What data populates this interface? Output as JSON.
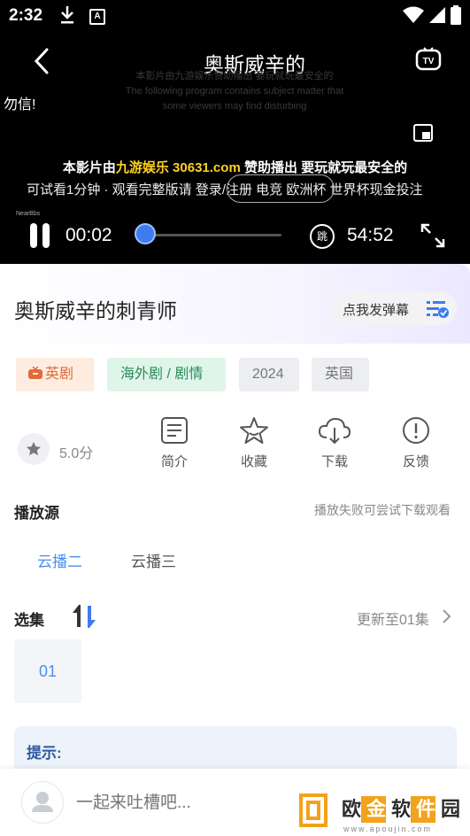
{
  "status_bar": {
    "time": "2:32",
    "notif_letter": "A"
  },
  "player": {
    "title": "奥斯威辛的",
    "danmaku_line": "勿信!",
    "faint_lines": [
      "本影片由九游娱乐赞助播出 要玩就玩最安全的",
      "The following program contains subject matter that",
      "some viewers may find disturbing"
    ],
    "sponsor_prefix": "本影片由",
    "sponsor_brand": "九游娱乐 30631.com",
    "sponsor_suffix": " 赞助播出 要玩就玩最安全的",
    "sponsor_line2": "世界杯现金投注",
    "overlay_line": "可试看1分钟 · 观看完整版请 登录/注册 电竞 欧洲杯 世界杯现金投注",
    "watermark_small": "NearBbs",
    "current_time": "00:02",
    "total_time": "54:52",
    "skip_char": "跳",
    "progress": 0.01
  },
  "info": {
    "title": "奥斯威辛的刺青师",
    "danmaku_button": "点我发弹幕",
    "tags": [
      "英剧",
      "海外剧 / 剧情",
      "2024",
      "英国"
    ],
    "rating": "5.0分",
    "actions": [
      {
        "label": "简介",
        "icon": "intro-icon"
      },
      {
        "label": "收藏",
        "icon": "star-icon"
      },
      {
        "label": "下载",
        "icon": "cloud-download-icon"
      },
      {
        "label": "反馈",
        "icon": "feedback-icon"
      }
    ]
  },
  "sources": {
    "title": "播放源",
    "hint": "播放失败可尝试下载观看",
    "items": [
      "云播二",
      "云播三"
    ],
    "selected": 0
  },
  "episodes": {
    "title": "选集",
    "update": "更新至01集",
    "items": [
      "01"
    ]
  },
  "tip": {
    "label": "提示:"
  },
  "comment": {
    "placeholder": "一起来吐槽吧..."
  },
  "watermark": {
    "chars": [
      "欧",
      "金",
      "软",
      "件",
      "园"
    ],
    "url": "www.apoujin.com"
  },
  "colors": {
    "accent": "#4a8ef0",
    "sponsor": "#ffd21f"
  }
}
